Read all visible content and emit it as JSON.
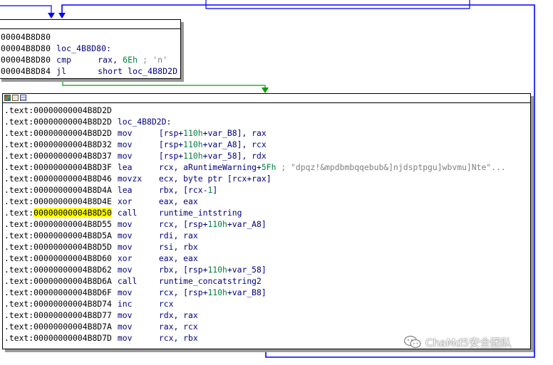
{
  "top_block": {
    "lines": [
      {
        "addr": "00004B8D80",
        "label": "",
        "mnem": "",
        "ops": []
      },
      {
        "addr": "00004B8D80",
        "label": "loc_4B8D80:",
        "mnem": "",
        "ops": []
      },
      {
        "addr": "00004B8D80",
        "label": "",
        "mnem": "cmp",
        "ops": [
          {
            "t": "op",
            "v": "rax, "
          },
          {
            "t": "num",
            "v": "6Eh"
          },
          {
            "t": "cmt",
            "v": " ; 'n'"
          }
        ]
      },
      {
        "addr": "00004B8D84",
        "label": "",
        "mnem": "jl",
        "ops": [
          {
            "t": "op",
            "v": "short loc_4B8D2D"
          }
        ]
      }
    ]
  },
  "main_block": {
    "header_icons": [
      "graph-color-icon",
      "edit-node-icon",
      "text-view-icon"
    ],
    "lines": [
      {
        "addr": ".text:00000000004B8D2D",
        "label": "",
        "mnem": "",
        "ops": []
      },
      {
        "addr": ".text:00000000004B8D2D",
        "label": "loc_4B8D2D:",
        "mnem": "",
        "ops": []
      },
      {
        "addr": ".text:00000000004B8D2D",
        "label": "",
        "mnem": "mov",
        "ops": [
          {
            "t": "op",
            "v": "[rsp+"
          },
          {
            "t": "num",
            "v": "110h"
          },
          {
            "t": "op",
            "v": "+var_B8], rax"
          }
        ]
      },
      {
        "addr": ".text:00000000004B8D32",
        "label": "",
        "mnem": "mov",
        "ops": [
          {
            "t": "op",
            "v": "[rsp+"
          },
          {
            "t": "num",
            "v": "110h"
          },
          {
            "t": "op",
            "v": "+var_A8], rcx"
          }
        ]
      },
      {
        "addr": ".text:00000000004B8D37",
        "label": "",
        "mnem": "mov",
        "ops": [
          {
            "t": "op",
            "v": "[rsp+"
          },
          {
            "t": "num",
            "v": "110h"
          },
          {
            "t": "op",
            "v": "+var_58], rdx"
          }
        ]
      },
      {
        "addr": ".text:00000000004B8D3F",
        "label": "",
        "mnem": "lea",
        "ops": [
          {
            "t": "op",
            "v": "rcx, aRuntimeWarning+"
          },
          {
            "t": "num",
            "v": "5Fh"
          },
          {
            "t": "cmt",
            "v": " ; \"dpqz!&mpdbmbqqebub&]njdsptpgu]wbvmu]Nte\"..."
          }
        ]
      },
      {
        "addr": ".text:00000000004B8D46",
        "label": "",
        "mnem": "movzx",
        "ops": [
          {
            "t": "op",
            "v": "ecx, byte ptr [rcx+rax]"
          }
        ]
      },
      {
        "addr": ".text:00000000004B8D4A",
        "label": "",
        "mnem": "lea",
        "ops": [
          {
            "t": "op",
            "v": "rbx, [rcx-"
          },
          {
            "t": "num",
            "v": "1"
          },
          {
            "t": "op",
            "v": "]"
          }
        ]
      },
      {
        "addr": ".text:00000000004B8D4E",
        "label": "",
        "mnem": "xor",
        "ops": [
          {
            "t": "op",
            "v": "eax, eax"
          }
        ]
      },
      {
        "addr_prefix": ".text:",
        "addr_hl": "00000000004B8D50",
        "label": "",
        "mnem": "call",
        "ops": [
          {
            "t": "op",
            "v": "runtime_intstring"
          }
        ]
      },
      {
        "addr": ".text:00000000004B8D55",
        "label": "",
        "mnem": "mov",
        "ops": [
          {
            "t": "op",
            "v": "rcx, [rsp+"
          },
          {
            "t": "num",
            "v": "110h"
          },
          {
            "t": "op",
            "v": "+var_A8]"
          }
        ]
      },
      {
        "addr": ".text:00000000004B8D5A",
        "label": "",
        "mnem": "mov",
        "ops": [
          {
            "t": "op",
            "v": "rdi, rax"
          }
        ]
      },
      {
        "addr": ".text:00000000004B8D5D",
        "label": "",
        "mnem": "mov",
        "ops": [
          {
            "t": "op",
            "v": "rsi, rbx"
          }
        ]
      },
      {
        "addr": ".text:00000000004B8D60",
        "label": "",
        "mnem": "xor",
        "ops": [
          {
            "t": "op",
            "v": "eax, eax"
          }
        ]
      },
      {
        "addr": ".text:00000000004B8D62",
        "label": "",
        "mnem": "mov",
        "ops": [
          {
            "t": "op",
            "v": "rbx, [rsp+"
          },
          {
            "t": "num",
            "v": "110h"
          },
          {
            "t": "op",
            "v": "+var_58]"
          }
        ]
      },
      {
        "addr": ".text:00000000004B8D6A",
        "label": "",
        "mnem": "call",
        "ops": [
          {
            "t": "op",
            "v": "runtime_concatstring2"
          }
        ]
      },
      {
        "addr": ".text:00000000004B8D6F",
        "label": "",
        "mnem": "mov",
        "ops": [
          {
            "t": "op",
            "v": "rcx, [rsp+"
          },
          {
            "t": "num",
            "v": "110h"
          },
          {
            "t": "op",
            "v": "+var_B8]"
          }
        ]
      },
      {
        "addr": ".text:00000000004B8D74",
        "label": "",
        "mnem": "inc",
        "ops": [
          {
            "t": "op",
            "v": "rcx"
          }
        ]
      },
      {
        "addr": ".text:00000000004B8D77",
        "label": "",
        "mnem": "mov",
        "ops": [
          {
            "t": "op",
            "v": "rdx, rax"
          }
        ]
      },
      {
        "addr": ".text:00000000004B8D7A",
        "label": "",
        "mnem": "mov",
        "ops": [
          {
            "t": "op",
            "v": "rax, rcx"
          }
        ]
      },
      {
        "addr": ".text:00000000004B8D7D",
        "label": "",
        "mnem": "mov",
        "ops": [
          {
            "t": "op",
            "v": "rcx, rbx"
          }
        ]
      }
    ]
  },
  "watermark": {
    "text": "ChaMd5安全团队",
    "icon": "wechat-icon"
  },
  "colors": {
    "edge_blue": "#0000ff",
    "edge_green": "#00a000",
    "highlight": "#ffff00",
    "text_navy": "#000080",
    "number_green": "#008040",
    "comment_gray": "#808080"
  }
}
